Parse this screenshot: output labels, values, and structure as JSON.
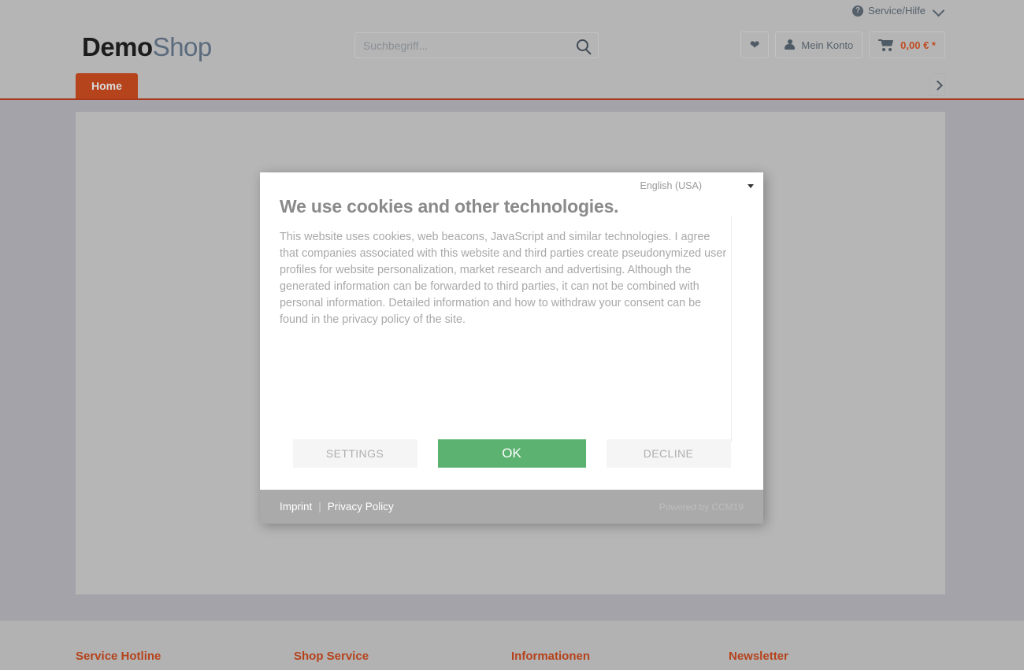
{
  "header": {
    "service_help": "Service/Hilfe",
    "help_icon": "question-circle-icon",
    "chevron_icon": "chevron-down-icon",
    "logo_primary": "Demo",
    "logo_secondary": "Shop",
    "search": {
      "placeholder": "Suchbegriff...",
      "value": "",
      "icon": "search-icon"
    },
    "actions": {
      "wishlist_icon": "heart-icon",
      "account_icon": "user-icon",
      "account_label": "Mein Konto",
      "cart_icon": "shopping-cart-icon",
      "cart_amount": "0,00 € *"
    }
  },
  "nav": {
    "home_label": "Home",
    "next_icon": "chevron-right-icon"
  },
  "cookie_dialog": {
    "language": "English (USA)",
    "language_caret_icon": "caret-down-icon",
    "title": "We use cookies and other technologies.",
    "body": "This website uses cookies, web beacons, JavaScript and similar technologies. I agree that companies associated with this website and third parties create pseudonymized user profiles for website personalization, market research and advertising. Although the generated information can be forwarded to third parties, it can not be combined with personal information. Detailed information and how to withdraw your consent can be found in the privacy policy of the site.",
    "buttons": {
      "settings": "SETTINGS",
      "ok": "OK",
      "decline": "DECLINE"
    },
    "footer": {
      "imprint": "Imprint",
      "separator": "|",
      "privacy_policy": "Privacy Policy",
      "powered_by": "Powered by CCM19"
    },
    "colors": {
      "accept_green": "#5cb270",
      "footer_gray": "#aaaaaa"
    }
  },
  "page_footer": {
    "columns": [
      {
        "title": "Service Hotline"
      },
      {
        "title": "Shop Service"
      },
      {
        "title": "Informationen"
      },
      {
        "title": "Newsletter"
      }
    ],
    "accent_color": "#b5431c"
  }
}
